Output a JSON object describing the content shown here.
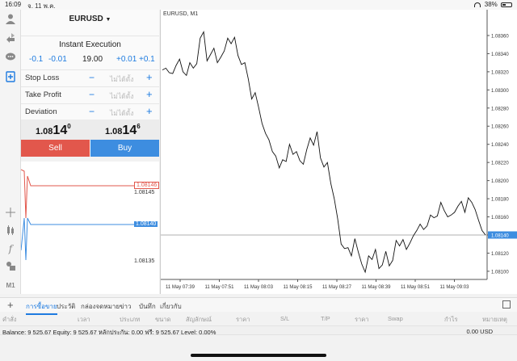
{
  "status": {
    "time": "16:09",
    "date": "จ. 11 พ.ค.",
    "battery": "38%"
  },
  "panel": {
    "symbol": "EURUSD",
    "execution": "Instant Execution",
    "volume_steps": [
      "-0.1",
      "-0.01",
      "19.00",
      "+0.01",
      "+0.1"
    ],
    "params": [
      {
        "label": "Stop Loss",
        "placeholder": "ไม่ได้ตั้ง"
      },
      {
        "label": "Take Profit",
        "placeholder": "ไม่ได้ตั้ง"
      },
      {
        "label": "Deviation",
        "placeholder": "ไม่ได้ตั้ง"
      }
    ],
    "bid": {
      "prefix": "1.08",
      "big": "14",
      "sup": "0"
    },
    "ask": {
      "prefix": "1.08",
      "big": "14",
      "sup": "6"
    },
    "sell_label": "Sell",
    "buy_label": "Buy"
  },
  "mini_chart": {
    "ask": "1.08146",
    "mid_high": "1.08145",
    "bid": "1.08140",
    "low": "1.08135",
    "ask_color": "#e2574c",
    "bid_color": "#3d8de0"
  },
  "chart_data": {
    "type": "line",
    "title": "EURUSD, M1",
    "x_ticks": [
      "11 May 07:39",
      "11 May 07:51",
      "11 May 08:03",
      "11 May 08:15",
      "11 May 08:27",
      "11 May 08:39",
      "11 May 08:51",
      "11 May 09:03"
    ],
    "y_ticks": [
      "1.08360",
      "1.08340",
      "1.08320",
      "1.08300",
      "1.08280",
      "1.08260",
      "1.08240",
      "1.08220",
      "1.08200",
      "1.08180",
      "1.08160",
      "1.08140",
      "1.08120",
      "1.08100"
    ],
    "ylim": [
      1.08091,
      1.08376
    ],
    "current_price": "1.08140",
    "current_value": 1.0814,
    "values": [
      1.08322,
      1.08324,
      1.08319,
      1.08318,
      1.08327,
      1.08334,
      1.0832,
      1.08316,
      1.0833,
      1.08324,
      1.08329,
      1.08357,
      1.08364,
      1.08332,
      1.08339,
      1.08346,
      1.0833,
      1.08336,
      1.08343,
      1.08357,
      1.08351,
      1.08358,
      1.08338,
      1.08328,
      1.0833,
      1.08312,
      1.0829,
      1.08297,
      1.08281,
      1.08263,
      1.08252,
      1.08245,
      1.08232,
      1.08227,
      1.08214,
      1.08223,
      1.08221,
      1.0824,
      1.08229,
      1.08232,
      1.08222,
      1.08218,
      1.08234,
      1.08247,
      1.08239,
      1.08254,
      1.08225,
      1.08215,
      1.0822,
      1.08197,
      1.0818,
      1.08158,
      1.0813,
      1.08125,
      1.08126,
      1.08117,
      1.08136,
      1.08121,
      1.08108,
      1.08099,
      1.08117,
      1.08113,
      1.08124,
      1.08103,
      1.08107,
      1.08122,
      1.08106,
      1.08112,
      1.08134,
      1.08128,
      1.08135,
      1.08124,
      1.08131,
      1.08139,
      1.08145,
      1.08152,
      1.08146,
      1.0815,
      1.08162,
      1.08159,
      1.08161,
      1.08176,
      1.08167,
      1.0816,
      1.08162,
      1.08165,
      1.08172,
      1.08177,
      1.08165,
      1.08181,
      1.08176,
      1.08168,
      1.08156,
      1.08145,
      1.0814
    ]
  },
  "tabs": [
    "การซื้อขาย",
    "ประวัติ",
    "กล่องจดหมาย",
    "ข่าว",
    "บันทึก",
    "เกี่ยวกับ"
  ],
  "columns": [
    "คำสั่ง",
    "เวลา",
    "ประเภท",
    "ขนาด",
    "สัญลักษณ์",
    "ราคา",
    "S/L",
    "T/P",
    "ราคา",
    "Swap",
    "กำไร",
    "หมายเหตุ"
  ],
  "balance": {
    "text": "Balance: 9 525.67 Equity: 9 525.67 หลักประกัน: 0.00 ฟรี: 9 525.67 Level: 0.00%",
    "profit": "0.00 USD"
  }
}
